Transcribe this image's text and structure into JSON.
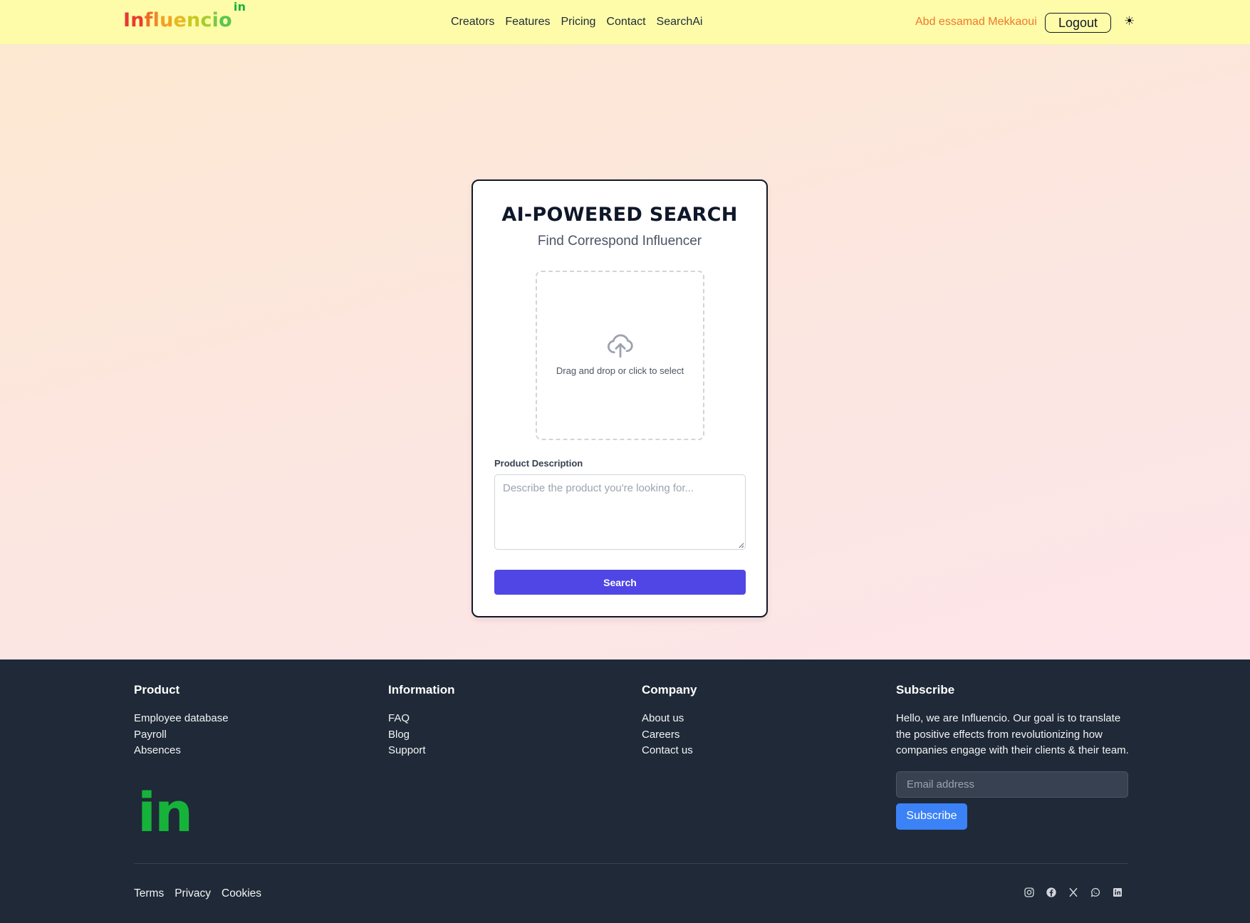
{
  "header": {
    "logo": {
      "letters": [
        "I",
        "n",
        "f",
        "l",
        "u",
        "e",
        "n",
        "c",
        "i",
        "o"
      ],
      "superscript": "in",
      "letter_colors": [
        "#e53935",
        "#ea3b2f",
        "#ef6c2a",
        "#f2862b",
        "#f5a023",
        "#e8b721",
        "#c9c91f",
        "#a6cd2b",
        "#7bc947",
        "#5ac54f"
      ],
      "superscript_color": "#16b33a"
    },
    "nav": [
      {
        "label": "Creators"
      },
      {
        "label": "Features"
      },
      {
        "label": "Pricing"
      },
      {
        "label": "Contact"
      },
      {
        "label": "SearchAi"
      }
    ],
    "user_name": "Abd essamad Mekkaoui",
    "logout_label": "Logout",
    "theme_icon": "☀",
    "accent_color": "#f0772f"
  },
  "search_card": {
    "title": "AI-POWERED SEARCH",
    "subtitle": "Find Correspond Influencer",
    "dropzone": {
      "icon": "cloud-upload-icon",
      "text": "Drag and drop or click to select"
    },
    "description_label": "Product Description",
    "description_placeholder": "Describe the product you're looking for...",
    "description_value": "",
    "search_label": "Search",
    "button_color": "#4f46e5"
  },
  "footer": {
    "product": {
      "heading": "Product",
      "links": [
        "Employee database",
        "Payroll",
        "Absences"
      ]
    },
    "information": {
      "heading": "Information",
      "links": [
        "FAQ",
        "Blog",
        "Support"
      ]
    },
    "company": {
      "heading": "Company",
      "links": [
        "About us",
        "Careers",
        "Contact us"
      ]
    },
    "subscribe": {
      "heading": "Subscribe",
      "text": "Hello, we are Influencio. Our goal is to translate the positive effects from revolutionizing how companies engage with their clients & their team.",
      "email_placeholder": "Email address",
      "email_value": "",
      "button_label": "Subscribe",
      "button_color": "#3b82f6"
    },
    "logo_text": "in",
    "logo_color": "#16b33a",
    "legal": [
      "Terms",
      "Privacy",
      "Cookies"
    ],
    "socials": [
      "instagram-icon",
      "facebook-icon",
      "x-icon",
      "whatsapp-icon",
      "linkedin-icon"
    ],
    "background": "#1f2937"
  }
}
